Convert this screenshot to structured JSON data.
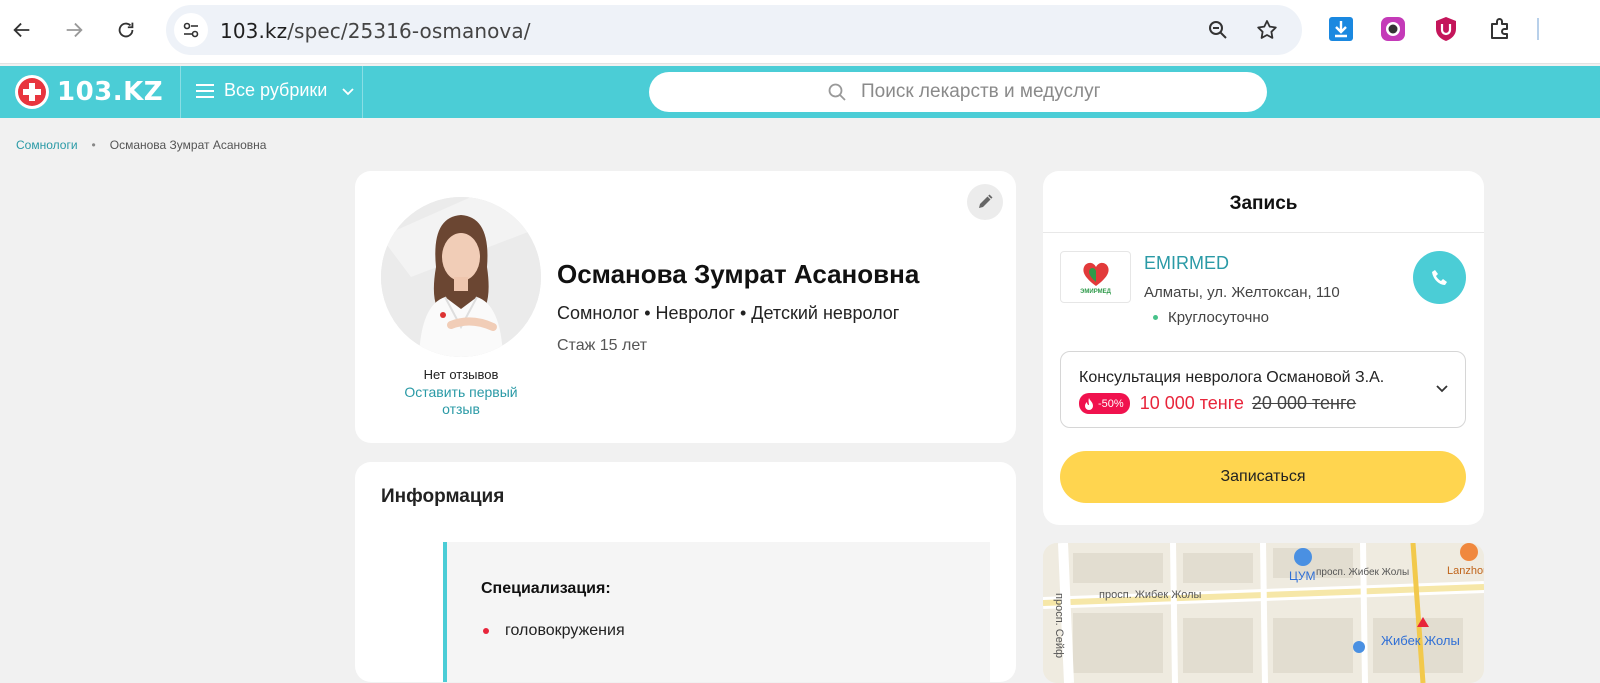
{
  "browser": {
    "url_host": "103.kz",
    "url_path": "/spec/25316-osmanova/"
  },
  "header": {
    "logo_text": "103.KZ",
    "rubrics_label": "Все рубрики",
    "search_placeholder": "Поиск лекарств и медуслуг"
  },
  "breadcrumb": {
    "parent": "Сомнологи",
    "separator": "•",
    "current": "Османова Зумрат Асановна"
  },
  "profile": {
    "name": "Османова Зумрат Асановна",
    "specialties": "Сомнолог • Невролог • Детский невролог",
    "experience": "Стаж 15 лет",
    "no_reviews": "Нет отзывов",
    "leave_review": "Оставить первый отзыв"
  },
  "info": {
    "title": "Информация",
    "spec_label": "Специализация:",
    "spec_items": [
      "головокружения"
    ]
  },
  "appointment": {
    "title": "Запись",
    "clinic_name": "EMIRMED",
    "clinic_logo_text": "ЭМИРМЕД",
    "clinic_address": "Алматы, ул. Желтоксан, 110",
    "clinic_hours": "Круглосуточно",
    "service_name": "Консультация невролога Османовой З.А.",
    "discount": "-50%",
    "price_new": "10 000 тенге",
    "price_old": "20 000 тенге",
    "book_label": "Записаться"
  },
  "map": {
    "labels": [
      "ЦУМ",
      "просп. Жибек Жолы",
      "просп. Жибек Жолы",
      "Lanzhou",
      "просп. Сейф",
      "Жибек Жолы"
    ]
  },
  "colors": {
    "brand": "#4bcdd6",
    "accent_red": "#e8253b",
    "book_button": "#ffd54f",
    "link": "#2a9aa6"
  }
}
